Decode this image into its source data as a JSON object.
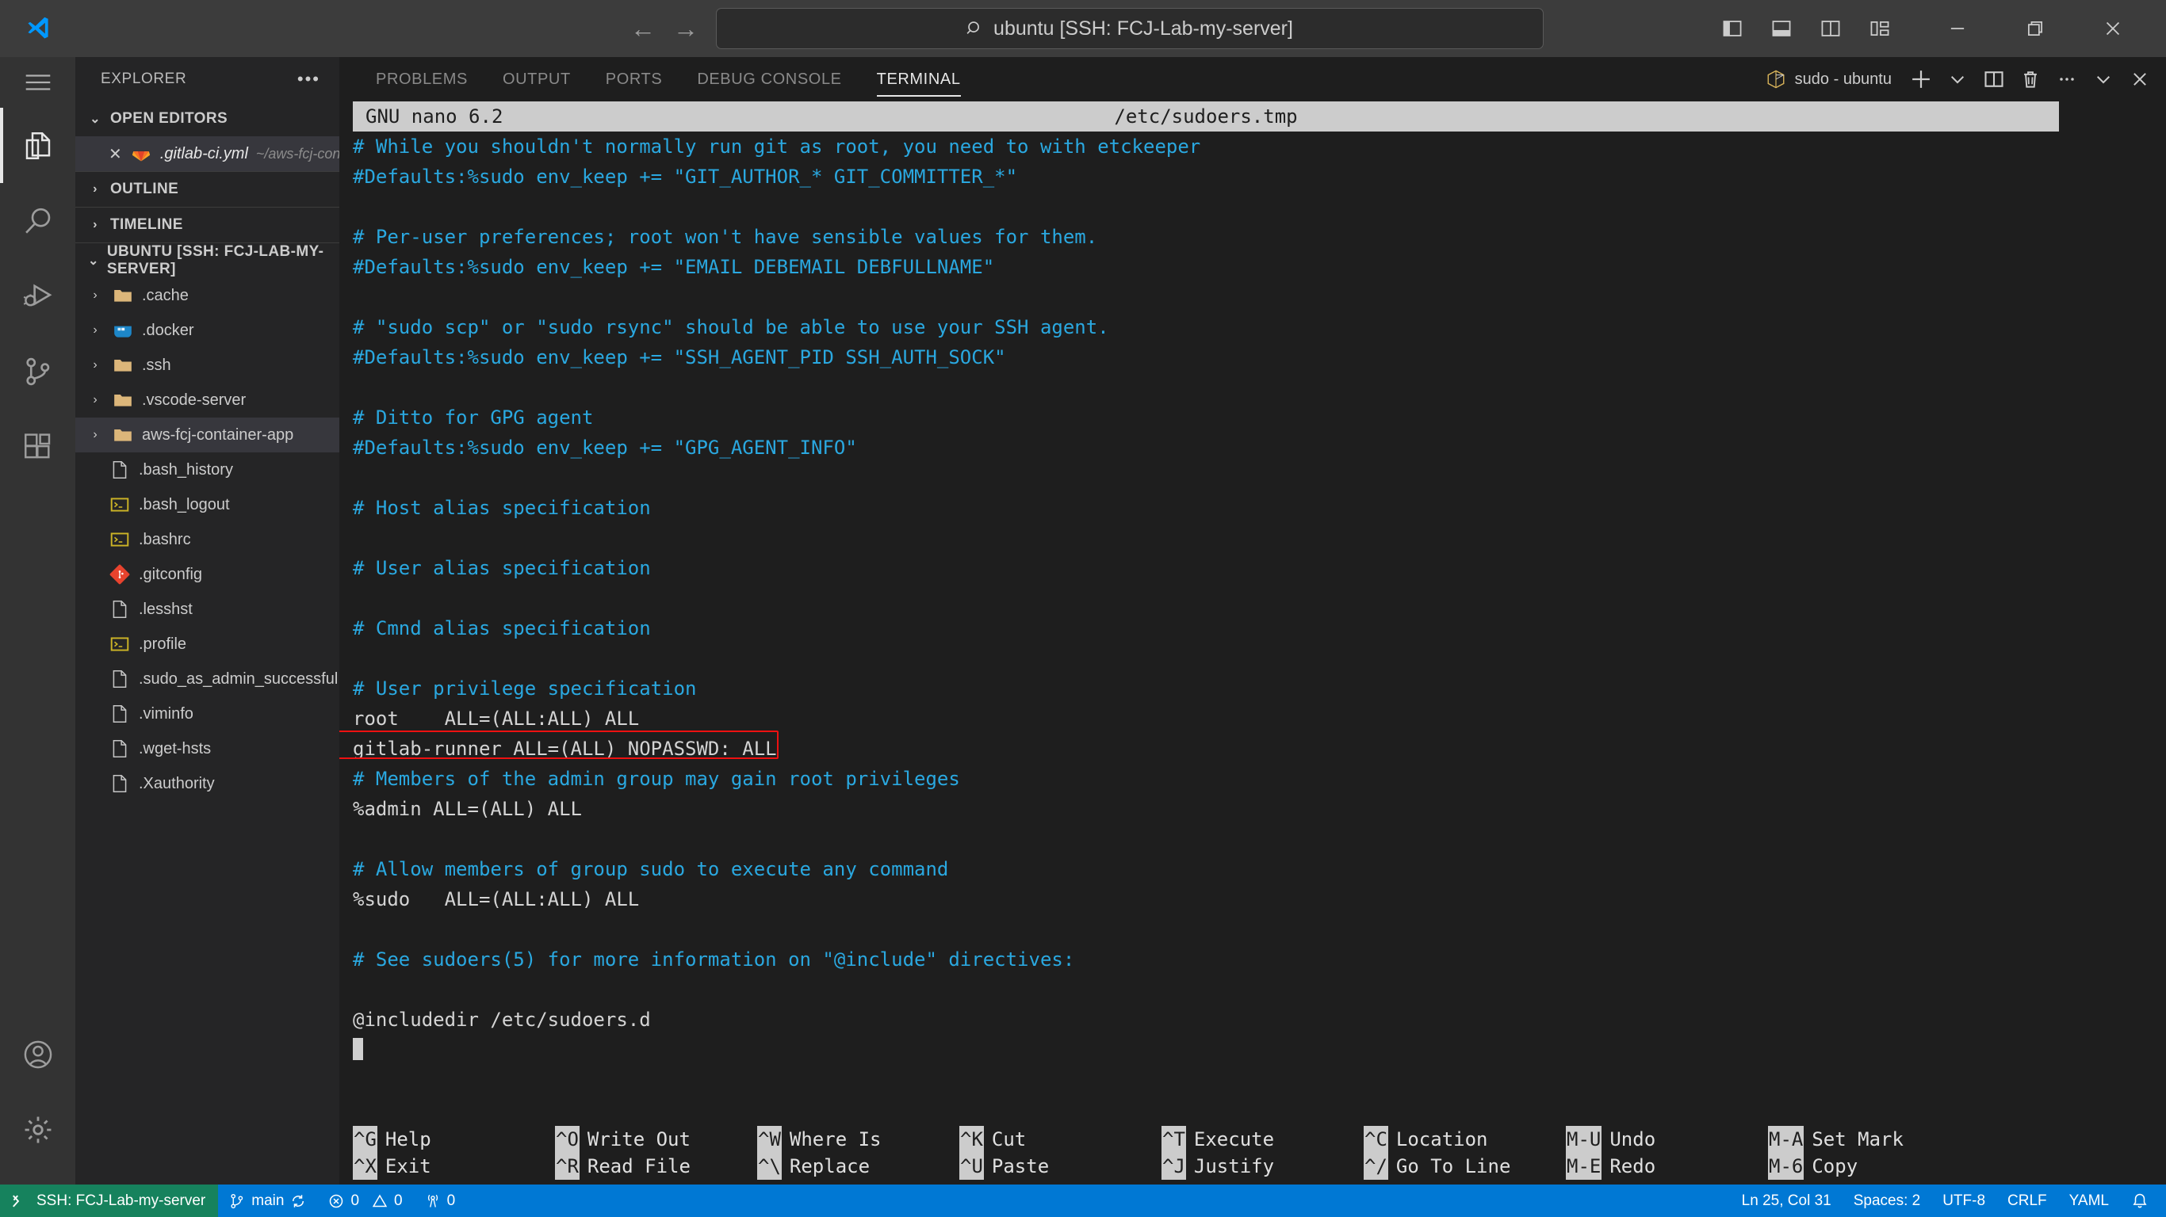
{
  "titlebar": {
    "search_text": "ubuntu [SSH: FCJ-Lab-my-server]",
    "back_glyph": "←",
    "forward_glyph": "→",
    "icons": [
      "toggle-primary-sidebar",
      "toggle-panel",
      "toggle-secondary-sidebar",
      "customize-layout",
      "minimize",
      "restore",
      "close"
    ]
  },
  "activitybar": {
    "items": [
      {
        "name": "explorer",
        "label": "Explorer"
      },
      {
        "name": "search",
        "label": "Search"
      },
      {
        "name": "run-and-debug",
        "label": "Run and Debug"
      },
      {
        "name": "source-control",
        "label": "Source Control"
      },
      {
        "name": "extensions",
        "label": "Extensions"
      }
    ],
    "bottom": [
      {
        "name": "accounts",
        "label": "Accounts"
      },
      {
        "name": "manage",
        "label": "Manage"
      }
    ]
  },
  "sidebar": {
    "title": "EXPLORER",
    "more_glyph": "•••",
    "open_editors": {
      "label": "OPEN EDITORS",
      "chevron": "⌄",
      "items": [
        {
          "close": "✕",
          "icon": "gitlab-icon",
          "name": ".gitlab-ci.yml",
          "path": "~/aws-fcj-contain..."
        }
      ]
    },
    "outline": {
      "label": "OUTLINE",
      "chevron": "›"
    },
    "timeline": {
      "label": "TIMELINE",
      "chevron": "›"
    },
    "workspace": {
      "label": "UBUNTU [SSH: FCJ-LAB-MY-SERVER]",
      "chevron": "⌄",
      "items": [
        {
          "label": ".cache",
          "icon": "folder-icon",
          "chevron": "›",
          "type": "folder",
          "selected": false
        },
        {
          "label": ".docker",
          "icon": "docker-icon",
          "chevron": "›",
          "type": "folder",
          "selected": false
        },
        {
          "label": ".ssh",
          "icon": "folder-icon",
          "chevron": "›",
          "type": "folder",
          "selected": false
        },
        {
          "label": ".vscode-server",
          "icon": "folder-icon",
          "chevron": "›",
          "type": "folder",
          "selected": false
        },
        {
          "label": "aws-fcj-container-app",
          "icon": "folder-icon",
          "chevron": "›",
          "type": "folder",
          "selected": true
        },
        {
          "label": ".bash_history",
          "icon": "file-icon",
          "chevron": "",
          "type": "file",
          "selected": false
        },
        {
          "label": ".bash_logout",
          "icon": "console-icon",
          "chevron": "",
          "type": "file",
          "selected": false
        },
        {
          "label": ".bashrc",
          "icon": "console-icon",
          "chevron": "",
          "type": "file",
          "selected": false
        },
        {
          "label": ".gitconfig",
          "icon": "git-icon",
          "chevron": "",
          "type": "file",
          "selected": false
        },
        {
          "label": ".lesshst",
          "icon": "file-icon",
          "chevron": "",
          "type": "file",
          "selected": false
        },
        {
          "label": ".profile",
          "icon": "console-icon",
          "chevron": "",
          "type": "file",
          "selected": false
        },
        {
          "label": ".sudo_as_admin_successful",
          "icon": "file-icon",
          "chevron": "",
          "type": "file",
          "selected": false
        },
        {
          "label": ".viminfo",
          "icon": "file-icon",
          "chevron": "",
          "type": "file",
          "selected": false
        },
        {
          "label": ".wget-hsts",
          "icon": "file-icon",
          "chevron": "",
          "type": "file",
          "selected": false
        },
        {
          "label": ".Xauthority",
          "icon": "file-icon",
          "chevron": "",
          "type": "file",
          "selected": false
        }
      ]
    }
  },
  "panel": {
    "tabs": [
      {
        "label": "PROBLEMS",
        "active": false
      },
      {
        "label": "OUTPUT",
        "active": false
      },
      {
        "label": "PORTS",
        "active": false
      },
      {
        "label": "DEBUG CONSOLE",
        "active": false
      },
      {
        "label": "TERMINAL",
        "active": true
      }
    ],
    "terminal_name": "sudo - ubuntu",
    "actions": [
      {
        "name": "new-terminal-icon",
        "glyph": "+"
      },
      {
        "name": "chevron-down-icon",
        "glyph": "⌄"
      },
      {
        "name": "split-terminal-icon",
        "glyph": ""
      },
      {
        "name": "kill-terminal-icon",
        "glyph": ""
      },
      {
        "name": "more-actions-icon",
        "glyph": "⋯"
      },
      {
        "name": "hide-panel-icon",
        "glyph": "⌄"
      },
      {
        "name": "close-panel-icon",
        "glyph": "✕"
      }
    ]
  },
  "terminal": {
    "nano_version": "GNU nano 6.2",
    "nano_filename": "/etc/sudoers.tmp",
    "lines": [
      {
        "text": "# While you shouldn't normally run git as root, you need to with etckeeper",
        "color": "cyan"
      },
      {
        "text": "#Defaults:%sudo env_keep += \"GIT_AUTHOR_* GIT_COMMITTER_*\"",
        "color": "cyan"
      },
      {
        "text": "",
        "color": "cyan"
      },
      {
        "text": "# Per-user preferences; root won't have sensible values for them.",
        "color": "cyan"
      },
      {
        "text": "#Defaults:%sudo env_keep += \"EMAIL DEBEMAIL DEBFULLNAME\"",
        "color": "cyan"
      },
      {
        "text": "",
        "color": "cyan"
      },
      {
        "text": "# \"sudo scp\" or \"sudo rsync\" should be able to use your SSH agent.",
        "color": "cyan"
      },
      {
        "text": "#Defaults:%sudo env_keep += \"SSH_AGENT_PID SSH_AUTH_SOCK\"",
        "color": "cyan"
      },
      {
        "text": "",
        "color": "cyan"
      },
      {
        "text": "# Ditto for GPG agent",
        "color": "cyan"
      },
      {
        "text": "#Defaults:%sudo env_keep += \"GPG_AGENT_INFO\"",
        "color": "cyan"
      },
      {
        "text": "",
        "color": "cyan"
      },
      {
        "text": "# Host alias specification",
        "color": "cyan"
      },
      {
        "text": "",
        "color": "cyan"
      },
      {
        "text": "# User alias specification",
        "color": "cyan"
      },
      {
        "text": "",
        "color": "cyan"
      },
      {
        "text": "# Cmnd alias specification",
        "color": "cyan"
      },
      {
        "text": "",
        "color": "cyan"
      },
      {
        "text": "# User privilege specification",
        "color": "cyan"
      },
      {
        "text": "root    ALL=(ALL:ALL) ALL",
        "color": "plain"
      },
      {
        "text": "gitlab-runner ALL=(ALL) NOPASSWD: ALL",
        "color": "plain"
      },
      {
        "text": "# Members of the admin group may gain root privileges",
        "color": "cyan"
      },
      {
        "text": "%admin ALL=(ALL) ALL",
        "color": "plain"
      },
      {
        "text": "",
        "color": "cyan"
      },
      {
        "text": "# Allow members of group sudo to execute any command",
        "color": "cyan"
      },
      {
        "text": "%sudo   ALL=(ALL:ALL) ALL",
        "color": "plain"
      },
      {
        "text": "",
        "color": "cyan"
      },
      {
        "text": "# See sudoers(5) for more information on \"@include\" directives:",
        "color": "cyan"
      },
      {
        "text": "",
        "color": "cyan"
      },
      {
        "text": "@includedir /etc/sudoers.d",
        "color": "plain"
      }
    ],
    "highlight": {
      "line_index": 20,
      "color": "#ee1111"
    },
    "shortcuts": [
      [
        {
          "key": "^G",
          "label": "Help"
        },
        {
          "key": "^X",
          "label": "Exit"
        }
      ],
      [
        {
          "key": "^O",
          "label": "Write Out"
        },
        {
          "key": "^R",
          "label": "Read File"
        }
      ],
      [
        {
          "key": "^W",
          "label": "Where Is"
        },
        {
          "key": "^\\",
          "label": "Replace"
        }
      ],
      [
        {
          "key": "^K",
          "label": "Cut"
        },
        {
          "key": "^U",
          "label": "Paste"
        }
      ],
      [
        {
          "key": "^T",
          "label": "Execute"
        },
        {
          "key": "^J",
          "label": "Justify"
        }
      ],
      [
        {
          "key": "^C",
          "label": "Location"
        },
        {
          "key": "^/",
          "label": "Go To Line"
        }
      ],
      [
        {
          "key": "M-U",
          "label": "Undo"
        },
        {
          "key": "M-E",
          "label": "Redo"
        }
      ],
      [
        {
          "key": "M-A",
          "label": "Set Mark"
        },
        {
          "key": "M-6",
          "label": "Copy"
        }
      ]
    ]
  },
  "statusbar": {
    "remote_label": "SSH: FCJ-Lab-my-server",
    "branch": "main",
    "sync_glyph": "↻",
    "errors": "0",
    "warnings": "0",
    "ports": "0",
    "position": "Ln 25, Col 31",
    "spaces": "Spaces: 2",
    "encoding": "UTF-8",
    "eol": "CRLF",
    "language": "YAML",
    "bell_glyph": "🔔",
    "remote_bg": "#16825d",
    "main_bg": "#0078d4"
  }
}
